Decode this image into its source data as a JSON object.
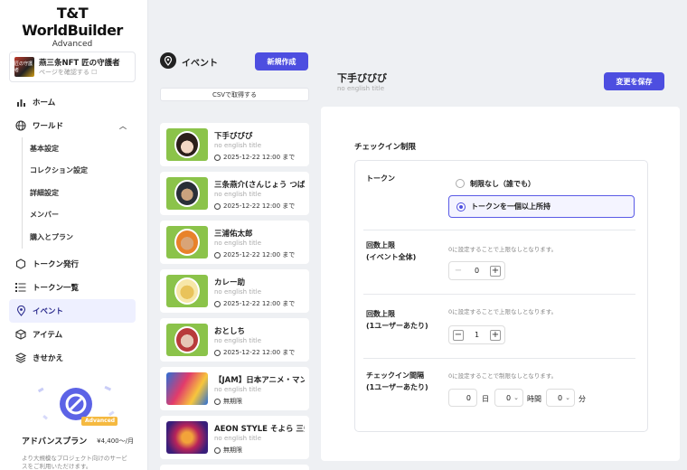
{
  "app": {
    "logo": "T&T WorldBuilder",
    "edition": "Advanced"
  },
  "org": {
    "name": "燕三条NFT 匠の守護者",
    "link": "ページを確認する ☐",
    "thumb_text": "匠の守護者"
  },
  "nav": {
    "home": "ホーム",
    "world": "ワールド",
    "world_sub": [
      "基本設定",
      "コレクション設定",
      "詳細設定",
      "メンバー",
      "購入とプラン"
    ],
    "token_issue": "トークン発行",
    "token_list": "トークン一覧",
    "event": "イベント",
    "item": "アイテム",
    "dressup": "きせかえ"
  },
  "plan": {
    "badge": "Advanced",
    "title": "アドバンスプラン",
    "price": "¥4,400〜/月",
    "desc": "より大規模なプロジェクト向けのサービスをご利用いただけます。"
  },
  "events_panel": {
    "title": "イベント",
    "new_button": "新規作成",
    "csv_button": "CSVで取得する",
    "items": [
      {
        "name": "下手びびび",
        "sub": "no english title",
        "date": "2025-12-22 12:00 まで"
      },
      {
        "name": "三条燕介(さんじょう つばめすけ)",
        "sub": "no english title",
        "date": "2025-12-22 12:00 まで"
      },
      {
        "name": "三浦佑太郎",
        "sub": "no english title",
        "date": "2025-12-22 12:00 まで"
      },
      {
        "name": "カレー助",
        "sub": "no english title",
        "date": "2025-12-22 12:00 まで"
      },
      {
        "name": "おとしち",
        "sub": "no english title",
        "date": "2025-12-22 12:00 まで"
      },
      {
        "name": "【JAM】日本アニメ・マンガ",
        "sub": "no english title",
        "date": "無期限"
      },
      {
        "name": "AEON STYLE そよら 三条",
        "sub": "no english title",
        "date": "無期限"
      }
    ]
  },
  "detail": {
    "title": "下手びびび",
    "subtitle": "no english title",
    "save_button": "変更を保存",
    "section": "チェックイン制限",
    "token": {
      "label": "トークン",
      "option_none": "制限なし（誰でも）",
      "option_hold": "トークンを一個以上所持",
      "selected": "option_hold"
    },
    "limit_total": {
      "label_line1": "回数上限",
      "label_line2": "(イベント全体)",
      "hint": "0に設定することで上限なしとなります。",
      "value": "0"
    },
    "limit_user": {
      "label_line1": "回数上限",
      "label_line2": "(1ユーザーあたり)",
      "hint": "0に設定することで上限なしとなります。",
      "value": "1"
    },
    "interval": {
      "label_line1": "チェックイン間隔",
      "label_line2": "(1ユーザーあたり)",
      "hint": "0に設定することで制限なしとなります。",
      "days": "0",
      "days_unit": "日",
      "hours": "0",
      "hours_unit": "時間",
      "minutes": "0",
      "minutes_unit": "分"
    }
  },
  "colors": {
    "accent": "#4d4ee0",
    "active_nav_bg": "#eef0ff",
    "thumb_green": "#8bc34a"
  }
}
